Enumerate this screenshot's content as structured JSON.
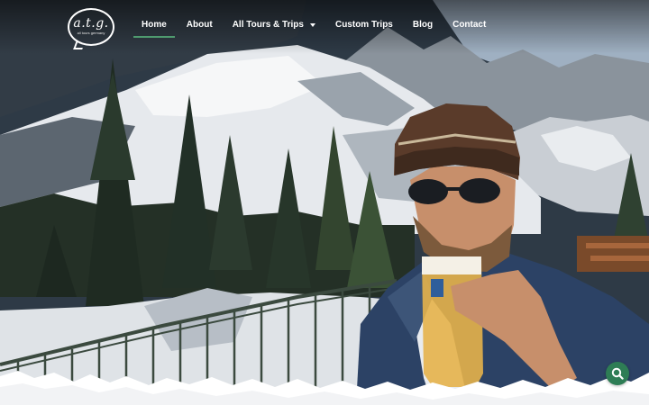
{
  "brand": {
    "logo_text": "a.t.g.",
    "logo_sub": "all tours germany"
  },
  "nav": {
    "items": [
      {
        "label": "Home",
        "active": true
      },
      {
        "label": "About"
      },
      {
        "label": "All Tours & Trips",
        "has_dropdown": true
      },
      {
        "label": "Custom Trips"
      },
      {
        "label": "Blog"
      },
      {
        "label": "Contact"
      }
    ],
    "accent_color": "#4f9b6f"
  },
  "hero": {
    "description": "",
    "icons": [
      "magnifier-icon"
    ]
  },
  "colors": {
    "search_button": "#2e7d55",
    "nav_text": "#ffffff"
  }
}
